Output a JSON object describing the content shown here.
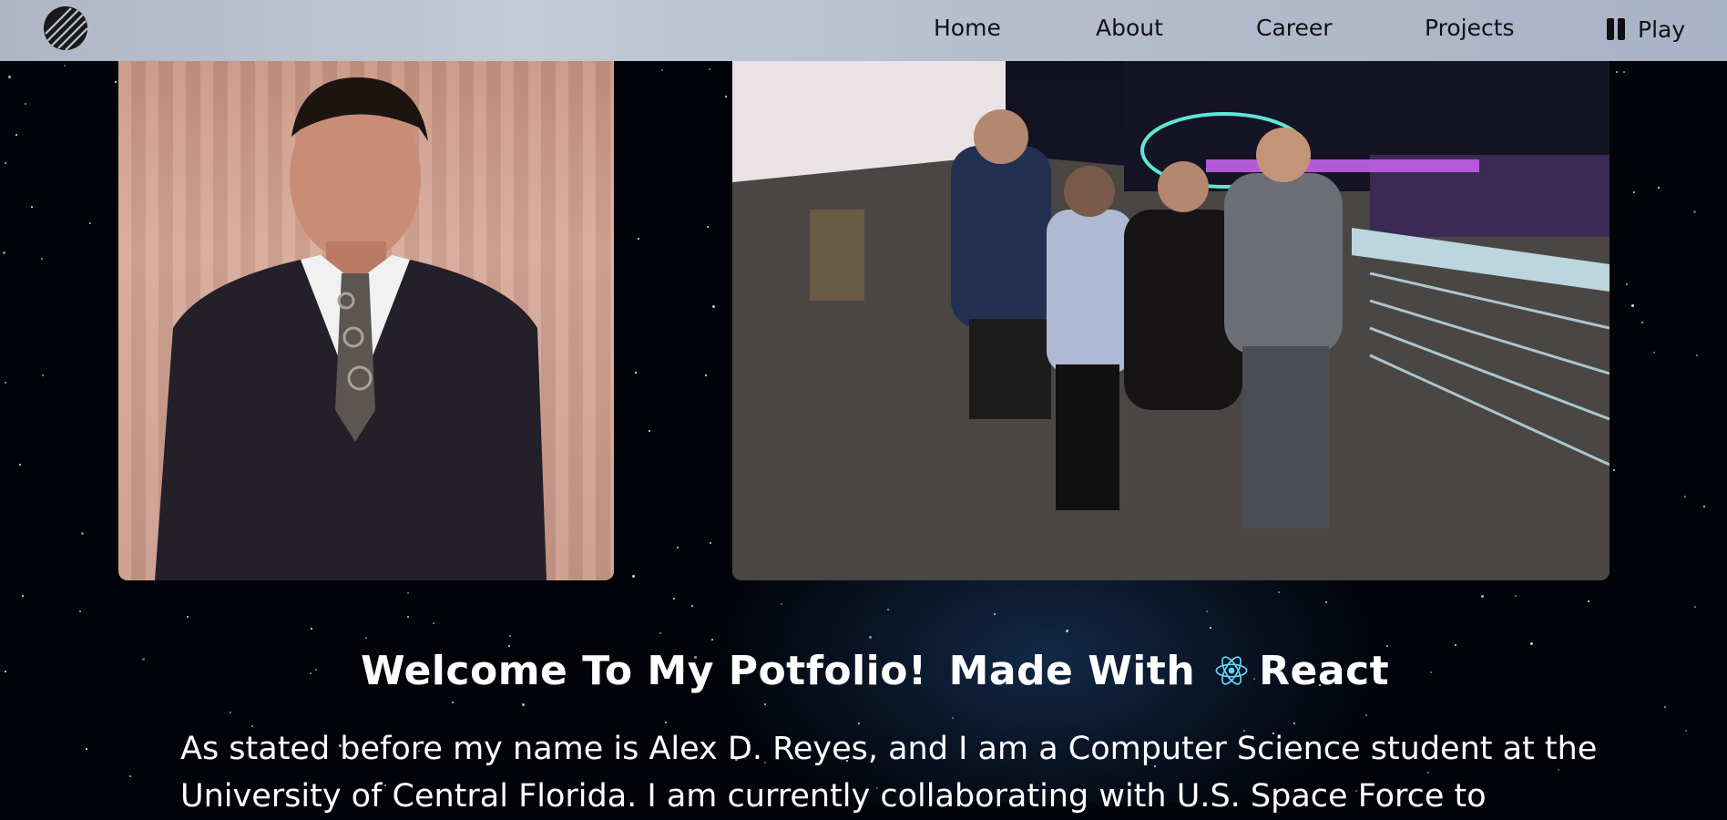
{
  "navbar": {
    "items": [
      {
        "label": "Home"
      },
      {
        "label": "About"
      },
      {
        "label": "Career"
      },
      {
        "label": "Projects"
      }
    ],
    "play_label": "Play",
    "logo_icon": "striped-circle-logo-icon",
    "pause_icon": "pause-icon"
  },
  "main": {
    "welcome_prefix": "Welcome To My Potfolio!",
    "welcome_made_with": "Made With",
    "welcome_react": "React",
    "react_icon": "react-atom-icon",
    "react_color": "#61dafb",
    "intro_line1": "As stated before my name is Alex D. Reyes, and I am a Computer Science student at the",
    "intro_line2": "University of Central Florida. I am currently collaborating with U.S. Space Force to"
  }
}
